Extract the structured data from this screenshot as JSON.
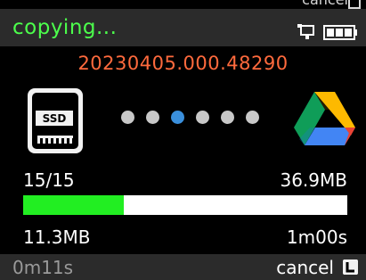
{
  "header": {
    "status": "copying...",
    "icons": [
      "plug-icon",
      "battery-icon"
    ]
  },
  "transfer": {
    "filename": "20230405.000.48290",
    "source_icon": "ssd-icon",
    "target_icon": "google-drive-icon",
    "progress_dots": {
      "count": 6,
      "active_index": 2
    },
    "file_count": "15/15",
    "total_size": "36.9MB",
    "copied_size": "11.3MB",
    "remaining_time": "1m00s",
    "progress_fraction": 0.31
  },
  "footer": {
    "elapsed": "0m11s",
    "cancel_label": "cancel"
  },
  "colors": {
    "status_green": "#4cff4c",
    "filename_orange": "#ff6a3d",
    "progress_green": "#22ee22",
    "dot_active_blue": "#3a8fdc",
    "bar_gray": "#2b2b2b"
  }
}
